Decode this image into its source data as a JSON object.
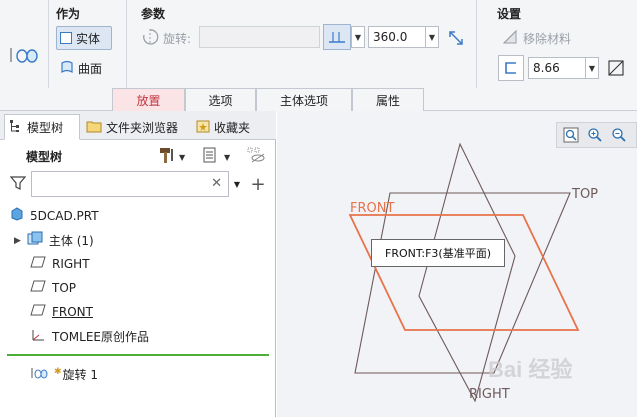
{
  "ribbon": {
    "group_as_label": "作为",
    "solid_label": "实体",
    "surface_label": "曲面",
    "params_label": "参数",
    "rotate_label": "旋转:",
    "angle_value": "360.0",
    "settings_label": "设置",
    "remove_material_label": "移除材料",
    "thickness_value": "8.66"
  },
  "tabs": [
    {
      "label": "放置",
      "active": true
    },
    {
      "label": "选项",
      "active": false
    },
    {
      "label": "主体选项",
      "active": false
    },
    {
      "label": "属性",
      "active": false
    }
  ],
  "panel_tabs": [
    {
      "label": "模型树"
    },
    {
      "label": "文件夹浏览器"
    },
    {
      "label": "收藏夹"
    }
  ],
  "tree": {
    "title": "模型树",
    "search_placeholder": "",
    "items": [
      {
        "label": "5DCAD.PRT"
      },
      {
        "label": "主体 (1)"
      },
      {
        "label": "RIGHT"
      },
      {
        "label": "TOP"
      },
      {
        "label": "FRONT"
      },
      {
        "label": "TOMLEE原创作品"
      }
    ],
    "feature_label": "旋转 1"
  },
  "graphics": {
    "tooltip": "FRONT:F3(基准平面)",
    "labels": {
      "front": "FRONT",
      "top": "TOP",
      "right": "RIGHT"
    },
    "watermark": "Bai 经验"
  },
  "colors": {
    "accent_red": "#c43540",
    "front_plane": "#e8734a",
    "plane_gray": "#6e5a5a",
    "active_green": "#4caf3a"
  }
}
